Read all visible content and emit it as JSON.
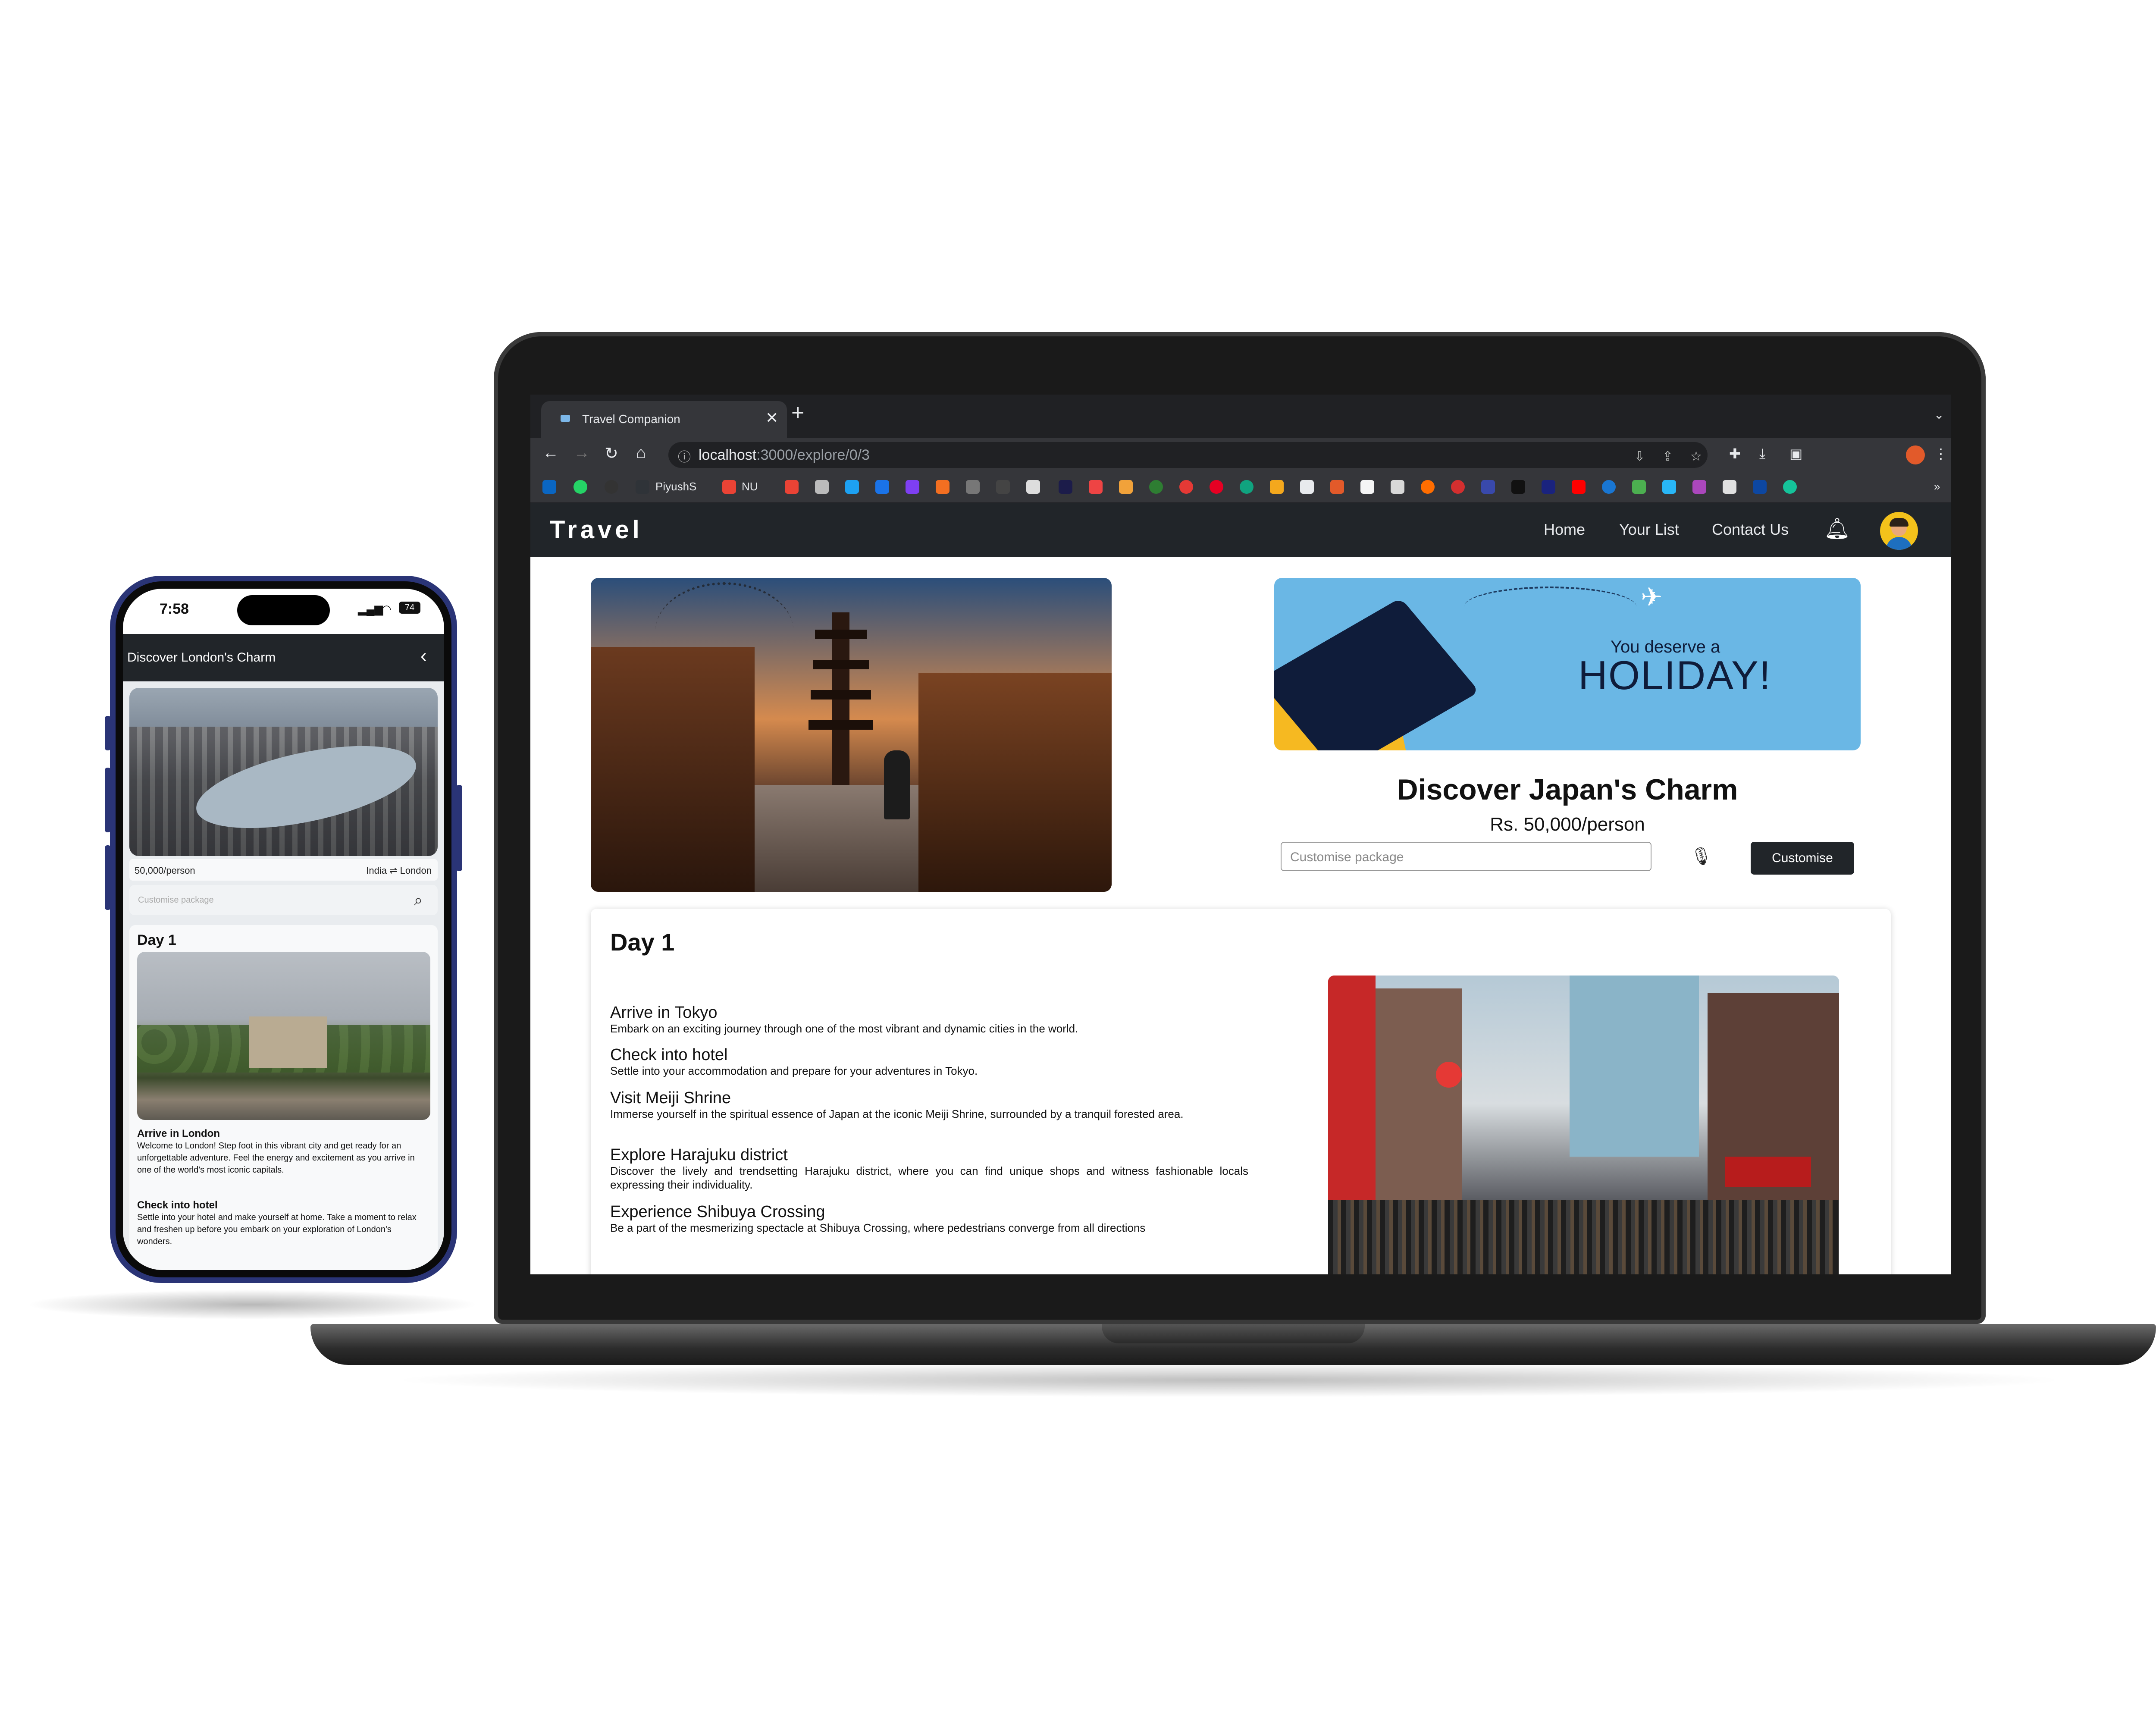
{
  "browser": {
    "tab_title": "Travel Companion",
    "tab_close": "✕",
    "new_tab": "+",
    "url_host": "localhost",
    "url_path": ":3000/explore/0/3",
    "bookmark_labels": [
      "PiyushS",
      "NU"
    ]
  },
  "navbar": {
    "brand": "Travel",
    "links": [
      "Home",
      "Your List",
      "Contact Us"
    ],
    "bell_icon": "bell-icon"
  },
  "hero": {
    "banner_small": "You deserve a",
    "banner_big": "HOLIDAY!",
    "title": "Discover Japan's Charm",
    "price": "Rs. 50,000/person",
    "input_placeholder": "Customise package",
    "button": "Customise"
  },
  "itinerary": {
    "day": "Day 1",
    "items": [
      {
        "title": "Arrive in Tokyo",
        "desc": "Embark on an exciting journey through one of the most vibrant and dynamic cities in the world."
      },
      {
        "title": "Check into hotel",
        "desc": "Settle into your accommodation and prepare for your adventures in Tokyo."
      },
      {
        "title": "Visit Meiji Shrine",
        "desc": "Immerse yourself in the spiritual essence of Japan at the iconic Meiji Shrine, surrounded by a tranquil forested area."
      },
      {
        "title": "Explore Harajuku district",
        "desc": "Discover the lively and trendsetting Harajuku district, where you can find unique shops and witness fashionable locals expressing their individuality."
      },
      {
        "title": "Experience Shibuya Crossing",
        "desc": "Be a part of the mesmerizing spectacle at Shibuya Crossing, where pedestrians converge from all directions"
      }
    ]
  },
  "phone": {
    "time": "7:58",
    "battery": "74",
    "header": "Discover London's Charm",
    "price": "50,000/person",
    "route": "India ⇌ London",
    "search_placeholder": "Customise package",
    "day": "Day 1",
    "items": [
      {
        "title": "Arrive in London",
        "desc": "Welcome to London! Step foot in this vibrant city and get ready for an unforgettable adventure. Feel the energy and excitement as you arrive in one of the world's most iconic capitals."
      },
      {
        "title": "Check into hotel",
        "desc": "Settle into your hotel and make yourself at home. Take a moment to relax and freshen up before you embark on your exploration of London's wonders."
      }
    ]
  },
  "colors": {
    "navbar": "#212529",
    "banner": "#6ab7e5",
    "phone_frame": "#2a3476"
  }
}
